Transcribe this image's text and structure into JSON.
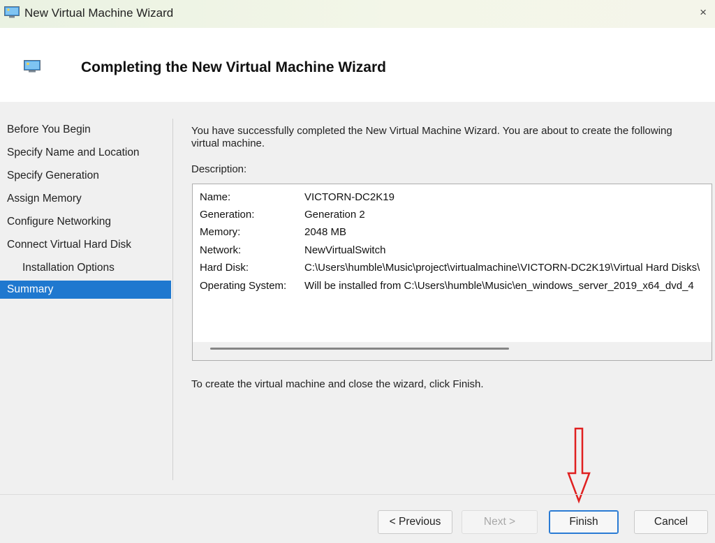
{
  "window": {
    "title": "New Virtual Machine Wizard",
    "close_glyph": "×",
    "icon": "virtual-machine-icon"
  },
  "header": {
    "title": "Completing the New Virtual Machine Wizard",
    "icon": "virtual-machine-icon"
  },
  "sidebar": {
    "items": [
      {
        "label": "Before You Begin",
        "sub": false,
        "active": false
      },
      {
        "label": "Specify Name and Location",
        "sub": false,
        "active": false
      },
      {
        "label": "Specify Generation",
        "sub": false,
        "active": false
      },
      {
        "label": "Assign Memory",
        "sub": false,
        "active": false
      },
      {
        "label": "Configure Networking",
        "sub": false,
        "active": false
      },
      {
        "label": "Connect Virtual Hard Disk",
        "sub": false,
        "active": false
      },
      {
        "label": "Installation Options",
        "sub": true,
        "active": false
      },
      {
        "label": "Summary",
        "sub": false,
        "active": true
      }
    ]
  },
  "main": {
    "intro": "You have successfully completed the New Virtual Machine Wizard. You are about to create the following virtual machine.",
    "description_label": "Description:",
    "details": [
      {
        "key": "Name:",
        "value": "VICTORN-DC2K19"
      },
      {
        "key": "Generation:",
        "value": "Generation 2"
      },
      {
        "key": "Memory:",
        "value": "2048 MB"
      },
      {
        "key": "Network:",
        "value": "NewVirtualSwitch"
      },
      {
        "key": "Hard Disk:",
        "value": "C:\\Users\\humble\\Music\\project\\virtualmachine\\VICTORN-DC2K19\\Virtual Hard Disks\\"
      },
      {
        "key": "Operating System:",
        "value": "Will be installed from C:\\Users\\humble\\Music\\en_windows_server_2019_x64_dvd_4"
      }
    ],
    "finish_note": "To create the virtual machine and close the wizard, click Finish."
  },
  "buttons": {
    "previous": "< Previous",
    "next": "Next >",
    "finish": "Finish",
    "cancel": "Cancel"
  },
  "annotation": {
    "arrow_color": "#e02020",
    "arrow_icon": "down-arrow-annotation-icon"
  },
  "colors": {
    "selection": "#1f78cf",
    "focus_border": "#2a7bd4"
  }
}
